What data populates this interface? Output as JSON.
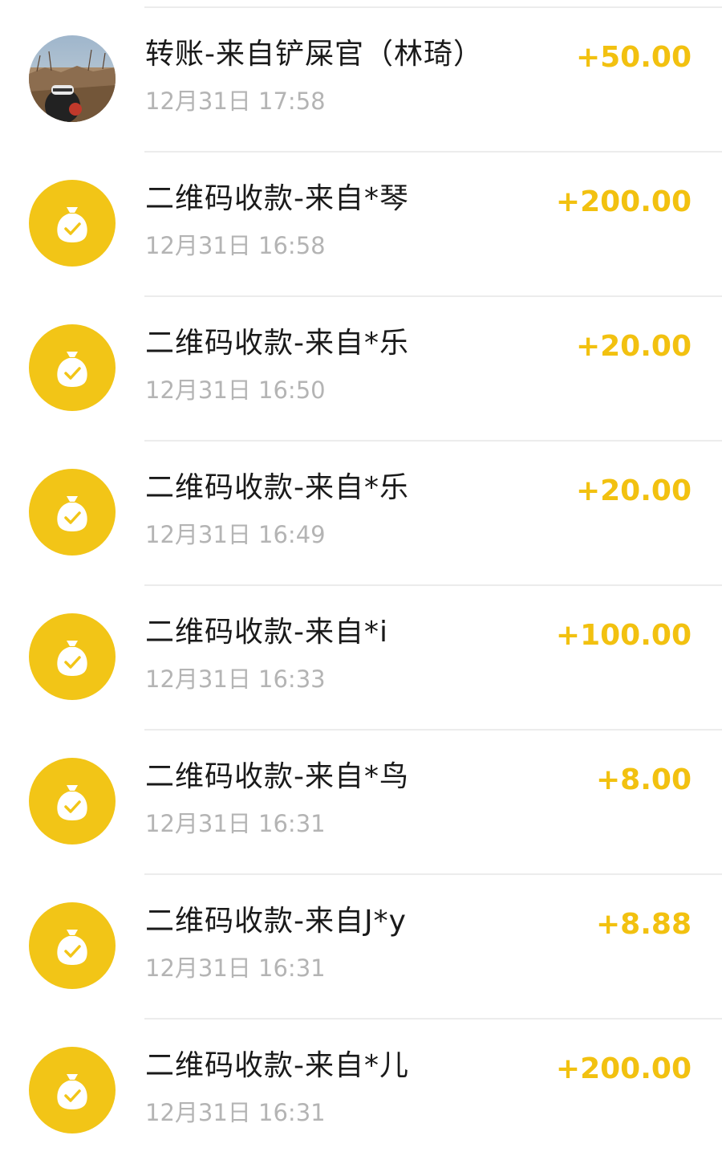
{
  "colors": {
    "accent": "#f2c517",
    "amount": "#f2c110",
    "title": "#1a1a1a",
    "time": "#b4b4b4",
    "divider": "#ececec"
  },
  "transactions": [
    {
      "icon": "user-avatar-photo",
      "title": "转账-来自铲屎官（林琦）",
      "time": "12月31日 17:58",
      "amount": "+50.00"
    },
    {
      "icon": "money-bag-icon",
      "title": "二维码收款-来自*琴",
      "time": "12月31日 16:58",
      "amount": "+200.00"
    },
    {
      "icon": "money-bag-icon",
      "title": "二维码收款-来自*乐",
      "time": "12月31日 16:50",
      "amount": "+20.00"
    },
    {
      "icon": "money-bag-icon",
      "title": "二维码收款-来自*乐",
      "time": "12月31日 16:49",
      "amount": "+20.00"
    },
    {
      "icon": "money-bag-icon",
      "title": "二维码收款-来自*i",
      "time": "12月31日 16:33",
      "amount": "+100.00"
    },
    {
      "icon": "money-bag-icon",
      "title": "二维码收款-来自*鸟",
      "time": "12月31日 16:31",
      "amount": "+8.00"
    },
    {
      "icon": "money-bag-icon",
      "title": "二维码收款-来自J*y",
      "time": "12月31日 16:31",
      "amount": "+8.88"
    },
    {
      "icon": "money-bag-icon",
      "title": "二维码收款-来自*儿",
      "time": "12月31日 16:31",
      "amount": "+200.00"
    }
  ]
}
